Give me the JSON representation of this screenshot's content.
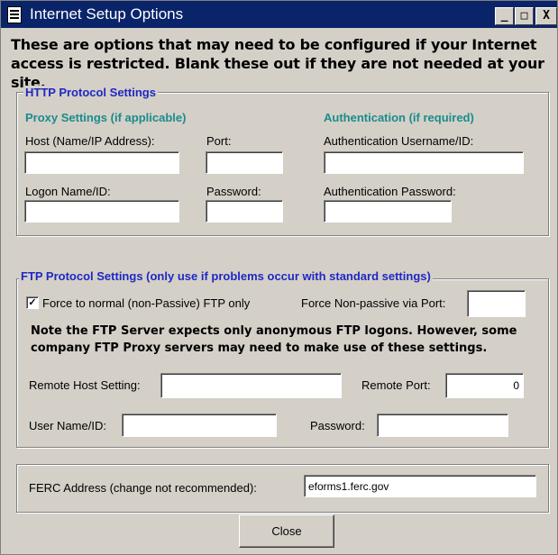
{
  "window": {
    "title": "Internet Setup Options"
  },
  "titlebar_buttons": {
    "minimize": "_",
    "maximize": "□",
    "close": "X"
  },
  "intro": "These are options that may need to be configured if your Internet access is restricted. Blank these out if they are not needed at your site.",
  "http": {
    "legend": "HTTP Protocol Settings",
    "proxy_heading": "Proxy Settings (if applicable)",
    "auth_heading": "Authentication (if required)",
    "host_label": "Host (Name/IP Address):",
    "host_value": "",
    "port_label": "Port:",
    "port_value": "",
    "logon_label": "Logon Name/ID:",
    "logon_value": "",
    "password_label": "Password:",
    "password_value": "",
    "auth_user_label": "Authentication Username/ID:",
    "auth_user_value": "",
    "auth_pass_label": "Authentication Password:",
    "auth_pass_value": ""
  },
  "ftp": {
    "legend": "FTP Protocol Settings (only use if problems occur with standard settings)",
    "force_normal_label": "Force to normal (non-Passive) FTP only",
    "force_normal_checked": true,
    "force_port_label": "Force Non-passive via Port:",
    "force_port_value": "",
    "note": "Note the FTP Server expects only anonymous FTP logons. However, some company FTP Proxy servers may need to make use of these settings.",
    "remote_host_label": "Remote Host Setting:",
    "remote_host_value": "",
    "remote_port_label": "Remote Port:",
    "remote_port_value": "0",
    "username_label": "User Name/ID:",
    "username_value": "",
    "password_label": "Password:",
    "password_value": ""
  },
  "ferc": {
    "label": "FERC Address (change not recommended):",
    "value": "eforms1.ferc.gov"
  },
  "close_label": "Close"
}
